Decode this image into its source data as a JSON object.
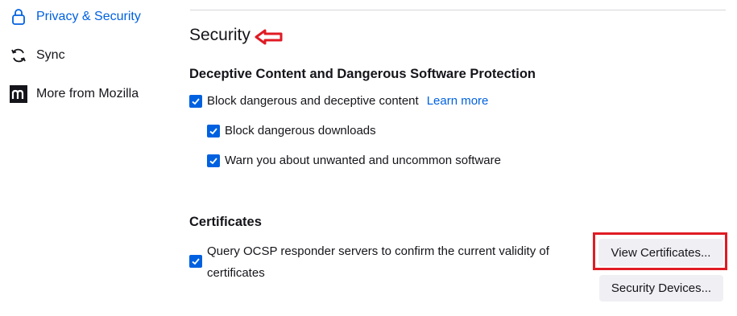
{
  "sidebar": {
    "items": [
      {
        "label": "Privacy & Security",
        "icon": "lock-icon",
        "active": true
      },
      {
        "label": "Sync",
        "icon": "sync-icon",
        "active": false
      },
      {
        "label": "More from Mozilla",
        "icon": "mozilla-logo-icon",
        "active": false
      }
    ]
  },
  "main": {
    "title": "Security",
    "deceptive": {
      "heading": "Deceptive Content and Dangerous Software Protection",
      "block_label": "Block dangerous and deceptive content",
      "learn_more": "Learn more",
      "downloads_label": "Block dangerous downloads",
      "unwanted_label": "Warn you about unwanted and uncommon software"
    },
    "certificates": {
      "heading": "Certificates",
      "ocsp_label": "Query OCSP responder servers to confirm the current validity of certificates",
      "view_button": "View Certificates...",
      "devices_button": "Security Devices..."
    }
  },
  "colors": {
    "accent": "#0061e0",
    "highlight": "#e01b24"
  }
}
